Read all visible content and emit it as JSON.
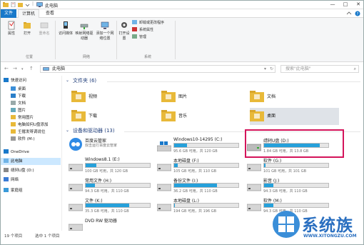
{
  "window": {
    "title": "此电脑",
    "minimize": "—",
    "maximize": "□",
    "close": "✕"
  },
  "tabs": [
    "文件",
    "计算机",
    "查看"
  ],
  "ribbon": {
    "location": {
      "properties": "属性",
      "open": "打开",
      "rename": "重命名",
      "group": "位置"
    },
    "network": {
      "access_media": "访问媒体",
      "map_drive": "映射网络驱动器",
      "add_location": "添加一个网络位置",
      "group": "网络"
    },
    "system": {
      "open_settings": "打开设置",
      "uninstall": "卸载或更改程序",
      "sys_props": "系统属性",
      "manage": "管理",
      "group": "系统"
    }
  },
  "address": {
    "path": "此电脑",
    "search_placeholder": "搜索\"此电脑\""
  },
  "sidebar": {
    "items": [
      {
        "label": "快速访问",
        "icon": "star-icon"
      },
      {
        "label": "桌面",
        "icon": "desktop-icon"
      },
      {
        "label": "下载",
        "icon": "download-icon"
      },
      {
        "label": "文档",
        "icon": "document-icon"
      },
      {
        "label": "图片",
        "icon": "picture-icon"
      },
      {
        "label": "常用图片",
        "icon": "folder-icon"
      },
      {
        "label": "电脑如何U盘添加",
        "icon": "folder-icon"
      },
      {
        "label": "壬撂发呀调说位",
        "icon": "folder-icon"
      },
      {
        "label": "软件 (M:)",
        "icon": "drive-icon"
      },
      {
        "label": "OneDrive",
        "icon": "cloud-icon"
      },
      {
        "label": "此电脑",
        "icon": "computer-icon"
      },
      {
        "label": "靖轲U盘 (D:)",
        "icon": "usb-icon"
      },
      {
        "label": "网络",
        "icon": "network-icon"
      },
      {
        "label": "家庭组",
        "icon": "homegroup-icon"
      }
    ]
  },
  "folders": {
    "header": "文件夹 (6)",
    "items": [
      {
        "label": "视频",
        "icon": "video-folder-icon"
      },
      {
        "label": "图片",
        "icon": "picture-folder-icon"
      },
      {
        "label": "文档",
        "icon": "document-folder-icon"
      },
      {
        "label": "下载",
        "icon": "download-folder-icon"
      },
      {
        "label": "音乐",
        "icon": "music-folder-icon"
      },
      {
        "label": "桌面",
        "icon": "desktop-folder-icon"
      }
    ]
  },
  "drives": {
    "header": "设备和驱动器 (13)",
    "items": [
      {
        "name": "百度云管家",
        "info": "双击运行百度云管家",
        "bar": false,
        "used": 0
      },
      {
        "name": "Windows10-14295 (C:)",
        "info": "95.6 GB 可用，共 120 GB",
        "bar": true,
        "used": 0.2
      },
      {
        "name": "靖轲U盘 (D:)",
        "info": "1.84 GB 可用，共 13.8 GB",
        "bar": true,
        "used": 0.87
      },
      {
        "name": "Windows8.1 (E:)",
        "info": "100 GB 可用，共 120 GB",
        "bar": true,
        "used": 0.17
      },
      {
        "name": "本地磁盘 (F:)",
        "info": "105 GB 可用，共 110 GB",
        "bar": true,
        "used": 0.05
      },
      {
        "name": "软件 (G:)",
        "info": "101 GB 可用，共 101 GB",
        "bar": true,
        "used": 0.02
      },
      {
        "name": "常用文件 (H:)",
        "info": "94.3 GB 可用，共 110 GB",
        "bar": true,
        "used": 0.14
      },
      {
        "name": "备份文件 (I:)",
        "info": "36.2 GB 可用，共 110 GB",
        "bar": true,
        "used": 0.67
      },
      {
        "name": "影音 (J:)",
        "info": "94.3 GB 可用，共 110 GB",
        "bar": true,
        "used": 0.14
      },
      {
        "name": "文件 (K:)",
        "info": "35.3 GB 可用，共 110 GB",
        "bar": true,
        "used": 0.68
      },
      {
        "name": "本地磁盘 (L:)",
        "info": "194 GB 可用，共 196 GB",
        "bar": true,
        "used": 0.01
      },
      {
        "name": "软件 (M:)",
        "info": "94.3 GB 可用，共 110 GB",
        "bar": true,
        "used": 0.14
      },
      {
        "name": "DVD RW 驱动器",
        "info": "",
        "bar": false,
        "used": 0
      }
    ]
  },
  "status": {
    "count": "19 个项目",
    "selected": "选中 1 个项目"
  },
  "logo": {
    "text": "系统族",
    "url": "WWW.XITONGZU.COM"
  },
  "colors": {
    "accent": "#26a0da",
    "highlight": "#d4145a",
    "folder": "#e8b939"
  }
}
